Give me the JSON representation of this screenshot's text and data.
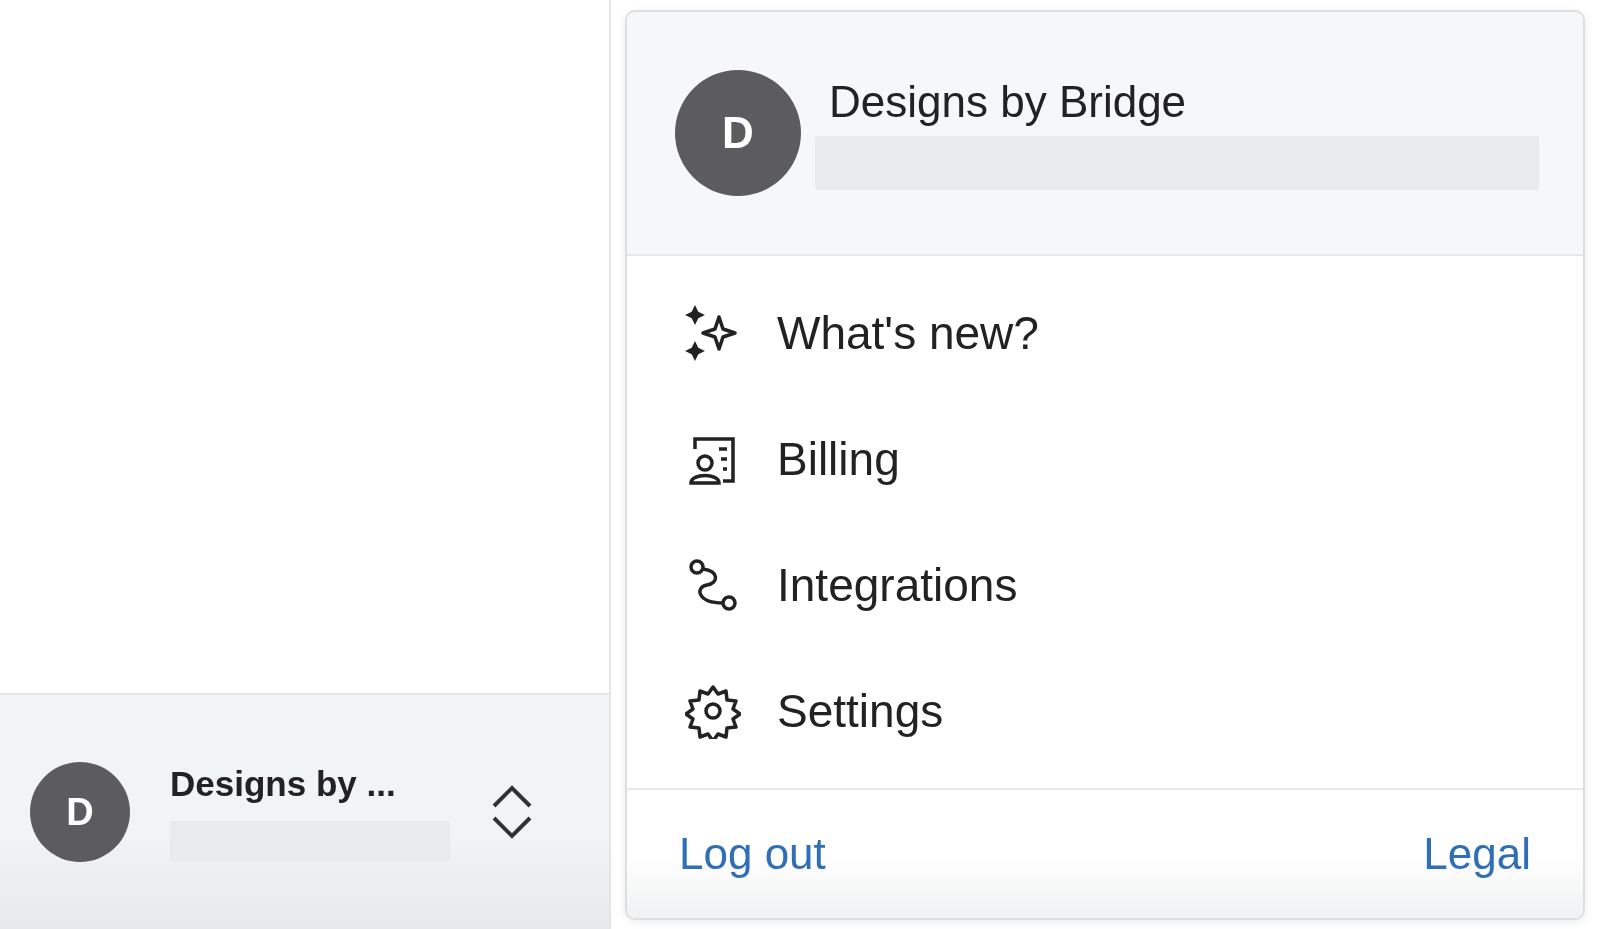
{
  "sidebar": {
    "account": {
      "avatar_letter": "D",
      "name": "Designs by ..."
    }
  },
  "account_menu": {
    "header": {
      "avatar_letter": "D",
      "name": "Designs by Bridge"
    },
    "items": [
      {
        "label": "What's new?"
      },
      {
        "label": "Billing"
      },
      {
        "label": "Integrations"
      },
      {
        "label": "Settings"
      }
    ],
    "footer": {
      "left_link": "Log out",
      "right_link": "Legal"
    }
  }
}
